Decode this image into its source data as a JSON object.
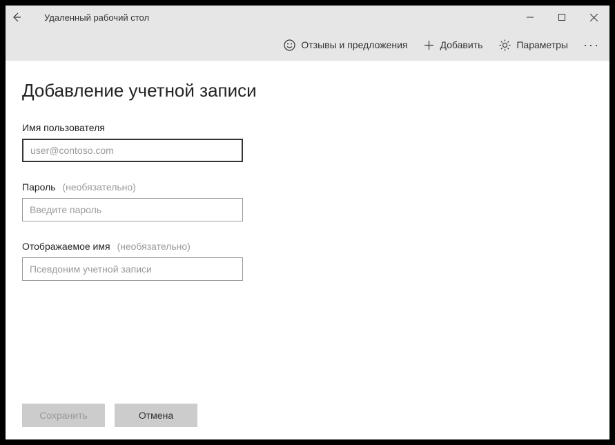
{
  "window": {
    "title": "Удаленный рабочий стол"
  },
  "commandbar": {
    "feedback": "Отзывы и предложения",
    "add": "Добавить",
    "settings": "Параметры"
  },
  "page": {
    "heading": "Добавление учетной записи",
    "username": {
      "label": "Имя пользователя",
      "placeholder": "user@contoso.com",
      "value": ""
    },
    "password": {
      "label": "Пароль",
      "optional": "(необязательно)",
      "placeholder": "Введите пароль",
      "value": ""
    },
    "displayname": {
      "label": "Отображаемое имя",
      "optional": "(необязательно)",
      "placeholder": "Псевдоним учетной записи",
      "value": ""
    },
    "buttons": {
      "save": "Сохранить",
      "cancel": "Отмена"
    }
  }
}
